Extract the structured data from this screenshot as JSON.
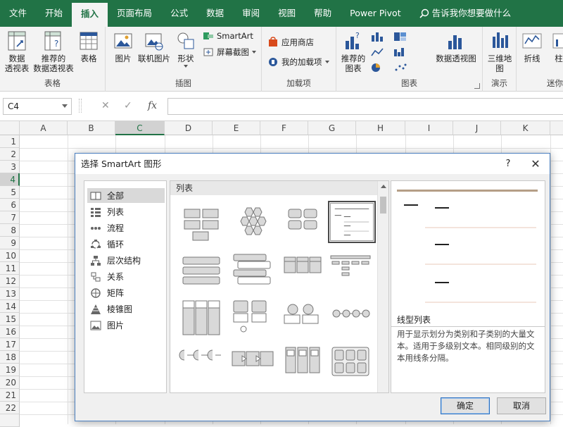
{
  "menubar": {
    "tabs": [
      "文件",
      "开始",
      "插入",
      "页面布局",
      "公式",
      "数据",
      "审阅",
      "视图",
      "帮助",
      "Power Pivot"
    ],
    "active_index": 2,
    "tell_me": "告诉我你想要做什么"
  },
  "ribbon": {
    "tables_group": {
      "label": "表格",
      "pivot": "数据\n透视表",
      "recommended_pivot": "推荐的\n数据透视表",
      "table": "表格"
    },
    "illustrations_group": {
      "label": "插图",
      "pictures": "图片",
      "online_pictures": "联机图片",
      "shapes": "形状",
      "smartart": "SmartArt",
      "screenshot": "屏幕截图"
    },
    "addins_group": {
      "label": "加载项",
      "store": "应用商店",
      "my_addins": "我的加载项"
    },
    "charts_group": {
      "label": "图表",
      "recommended_charts": "推荐的\n图表",
      "pivot_chart": "数据透视图"
    },
    "tours_group": {
      "label": "演示",
      "map_3d": "三维地\n图"
    },
    "sparklines_group": {
      "label": "迷你",
      "line": "折线",
      "column": "柱"
    }
  },
  "formula_bar": {
    "name_box": "C4",
    "cancel": "✕",
    "enter": "✓",
    "fx": "fx",
    "value": ""
  },
  "grid": {
    "columns": [
      "A",
      "B",
      "C",
      "D",
      "E",
      "F",
      "G",
      "H",
      "I",
      "J",
      "K"
    ],
    "selected_column": "C",
    "rows": [
      "1",
      "2",
      "3",
      "4",
      "5",
      "6",
      "7",
      "8",
      "9",
      "10",
      "11",
      "12",
      "13",
      "14",
      "15",
      "16",
      "17",
      "18",
      "19",
      "20",
      "21",
      "22"
    ],
    "selected_row": "4"
  },
  "dialog": {
    "title": "选择 SmartArt 图形",
    "help": "?",
    "close": "✕",
    "categories": [
      {
        "label": "全部",
        "icon": "all-icon"
      },
      {
        "label": "列表",
        "icon": "list-icon"
      },
      {
        "label": "流程",
        "icon": "process-icon"
      },
      {
        "label": "循环",
        "icon": "cycle-icon"
      },
      {
        "label": "层次结构",
        "icon": "hierarchy-icon"
      },
      {
        "label": "关系",
        "icon": "relationship-icon"
      },
      {
        "label": "矩阵",
        "icon": "matrix-icon"
      },
      {
        "label": "棱锥图",
        "icon": "pyramid-icon"
      },
      {
        "label": "图片",
        "icon": "picture-icon"
      }
    ],
    "selected_category": "全部",
    "gallery_heading": "列表",
    "preview_name": "线型列表",
    "preview_description": "用于显示划分为类别和子类别的大量文本。适用于多级别文本。相同级别的文本用线条分隔。",
    "ok": "确定",
    "cancel": "取消"
  },
  "colors": {
    "excel_green": "#217346",
    "dialog_border": "#4a7fbf",
    "accent_brown": "#b59e86"
  }
}
